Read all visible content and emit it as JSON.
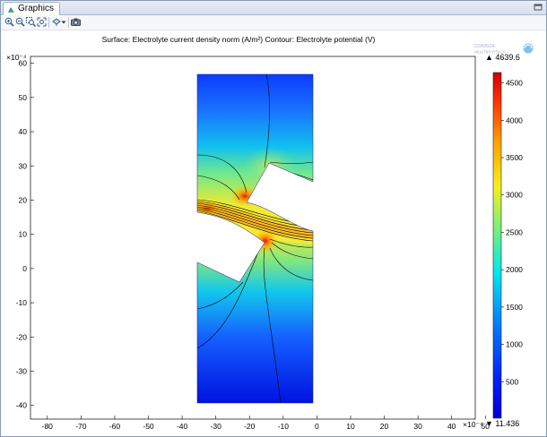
{
  "window": {
    "tab_title": "Graphics"
  },
  "toolbar": {
    "buttons": [
      "zoom-in-icon",
      "zoom-out-icon",
      "zoom-box-icon",
      "zoom-extents-icon",
      "scene-light-icon",
      "image-snapshot-icon"
    ]
  },
  "plot": {
    "title": "Surface: Electrolyte current density norm (A/m²)  Contour: Electrolyte potential (V)",
    "y_exponent": "×10⁻⁴",
    "x_exponent": "×10⁻⁴",
    "x_ticks": [
      "-80",
      "-70",
      "-60",
      "-50",
      "-40",
      "-30",
      "-20",
      "-10",
      "0",
      "10",
      "20",
      "30",
      "40",
      "50"
    ],
    "y_ticks": [
      "60",
      "50",
      "40",
      "30",
      "20",
      "10",
      "0",
      "-10",
      "-20",
      "-30",
      "-40"
    ],
    "xlim": [
      -85,
      47
    ],
    "ylim": [
      -44,
      62
    ]
  },
  "colorbar": {
    "max_label": "▲ 4639.6",
    "min_label": "▼ 11.436",
    "ticks": [
      "500",
      "1000",
      "1500",
      "2000",
      "2500",
      "3000",
      "3500",
      "4000",
      "4500"
    ],
    "range": [
      11.436,
      4639.6
    ]
  },
  "logo": {
    "line1": "COMSOL",
    "line2": "MULTIPHYSICS"
  }
}
